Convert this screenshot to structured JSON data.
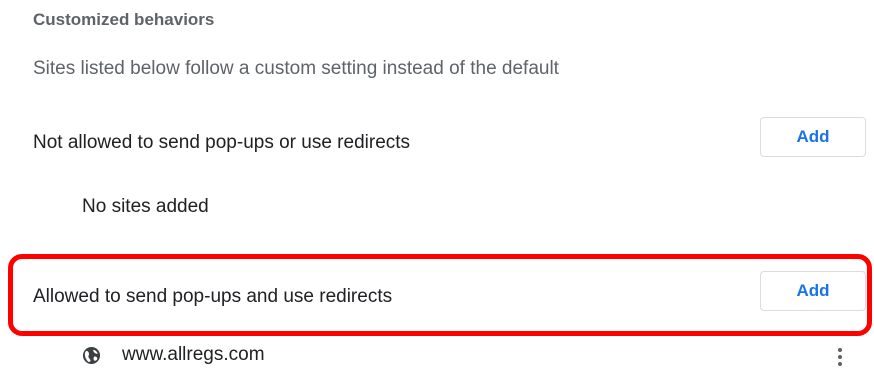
{
  "section": {
    "title": "Customized behaviors",
    "subtitle": "Sites listed below follow a custom setting instead of the default"
  },
  "blocked": {
    "label": "Not allowed to send pop-ups or use redirects",
    "add_label": "Add",
    "empty_text": "No sites added"
  },
  "allowed": {
    "label": "Allowed to send pop-ups and use redirects",
    "add_label": "Add",
    "sites": [
      {
        "url": "www.allregs.com",
        "icon": "globe-icon"
      }
    ]
  },
  "highlight": {
    "color": "#ff0000"
  },
  "colors": {
    "accent": "#1a73e8",
    "secondary_text": "#5f6368",
    "primary_text": "#202124"
  }
}
